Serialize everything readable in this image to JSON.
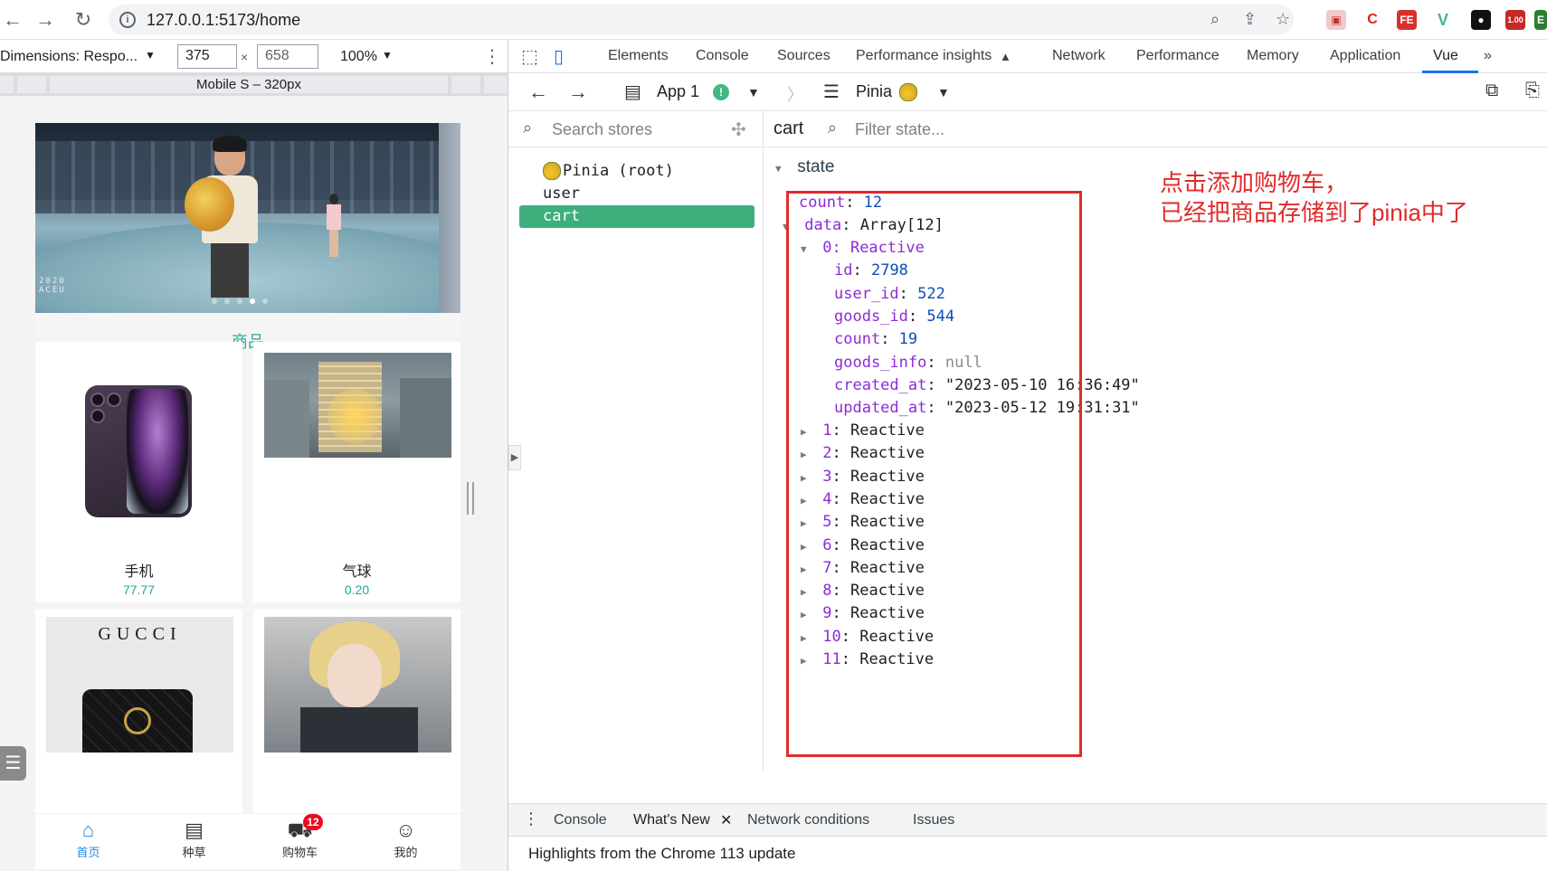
{
  "browser": {
    "url": "127.0.0.1:5173/home"
  },
  "device_toolbar": {
    "dimensions_label": "Dimensions: Respo...",
    "width": "375",
    "height": "658",
    "zoom": "100%",
    "ruler_label": "Mobile S – 320px"
  },
  "app": {
    "section_title": "商品",
    "banner_stamp_1": "2020",
    "banner_stamp_2": "ACEU",
    "products": [
      {
        "name": "手机",
        "price": "77.77"
      },
      {
        "name": "气球",
        "price": "0.20"
      },
      {
        "name": "",
        "price": ""
      },
      {
        "name": "",
        "price": ""
      }
    ],
    "gucci_brand": "GUCCI",
    "tabs": [
      {
        "label": "首页",
        "icon": "home-icon"
      },
      {
        "label": "种草",
        "icon": "note-icon"
      },
      {
        "label": "购物车",
        "icon": "cart-icon",
        "badge": "12"
      },
      {
        "label": "我的",
        "icon": "user-icon"
      }
    ]
  },
  "devtools": {
    "tabs": [
      "Elements",
      "Console",
      "Sources",
      "Performance insights",
      "Network",
      "Performance",
      "Memory",
      "Application",
      "Vue"
    ],
    "active_tab": "Vue",
    "vue_toolbar": {
      "app_label": "App 1",
      "plugin_label": "Pinia"
    },
    "stores_search_placeholder": "Search stores",
    "stores": [
      "Pinia (root)",
      "user",
      "cart"
    ],
    "selected_store": "cart",
    "filter_placeholder": "Filter state...",
    "state_title": "cart",
    "state_label": "state",
    "state": {
      "count": "12",
      "data_label": "Array[12]",
      "item0_label": "0: Reactive",
      "item0": {
        "id": "2798",
        "user_id": "522",
        "goods_id": "544",
        "count": "19",
        "goods_info": "null",
        "created_at": "\"2023-05-10 16:36:49\"",
        "updated_at": "\"2023-05-12 19:31:31\""
      },
      "collapsed_items": [
        "1",
        "2",
        "3",
        "4",
        "5",
        "6",
        "7",
        "8",
        "9",
        "10",
        "11"
      ],
      "collapsed_value": "Reactive"
    },
    "drawer_tabs": [
      "Console",
      "What's New",
      "Network conditions",
      "Issues"
    ],
    "drawer_active": "What's New",
    "drawer_text": "Highlights from the Chrome 113 update"
  },
  "annotation": {
    "line1": "点击添加购物车，",
    "line2": "已经把商品存储到了pinia中了",
    "color": "#e02b2b"
  },
  "colors": {
    "accent_teal": "#26a69a",
    "tab_active_blue": "#1e88e5",
    "vue_green": "#3eaf7c",
    "badge_red": "#ee0a24"
  }
}
